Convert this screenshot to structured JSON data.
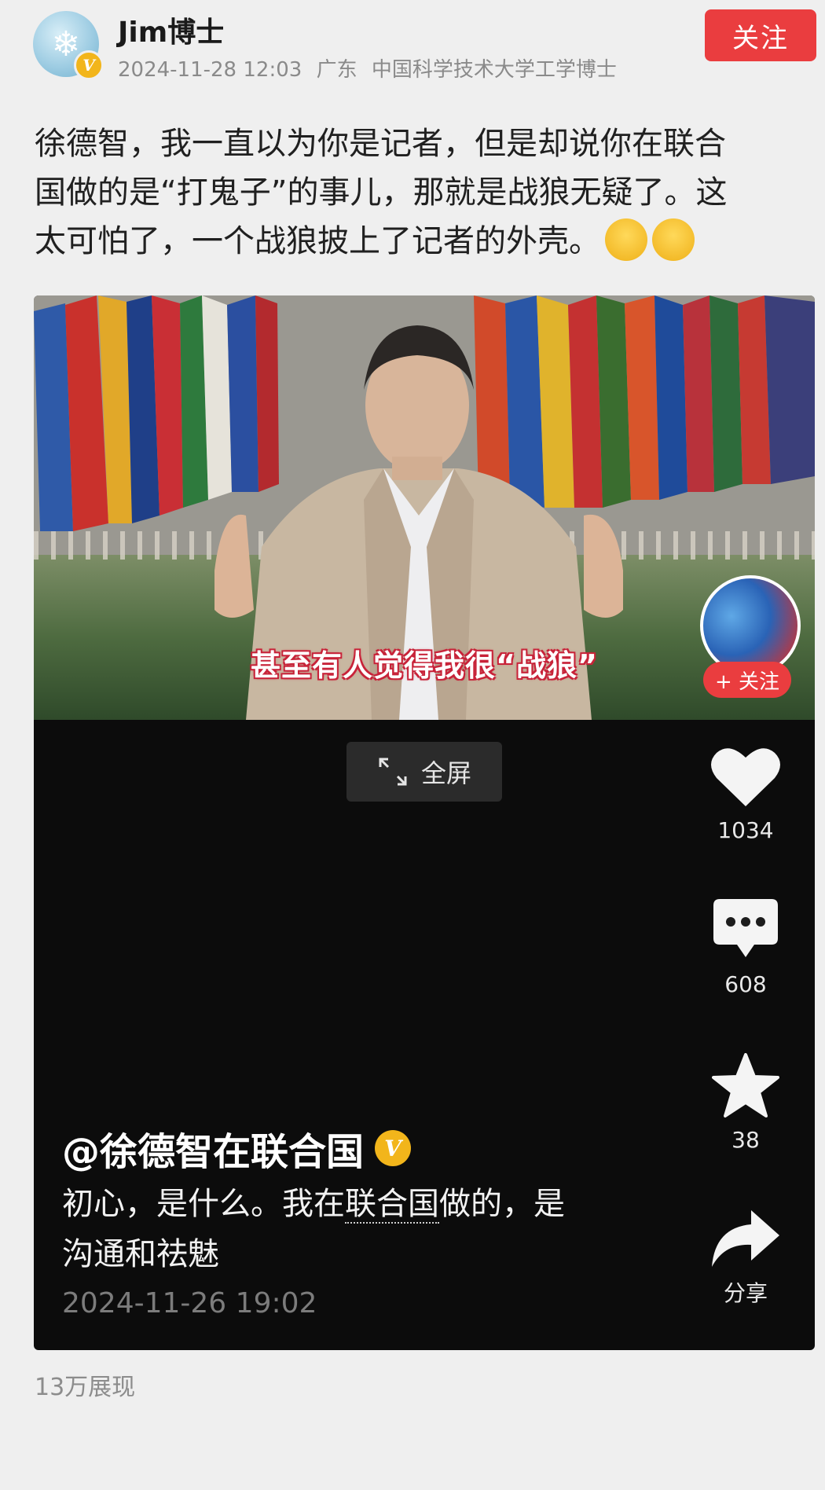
{
  "post": {
    "author": "Jim博士",
    "timestamp": "2024-11-28 12:03",
    "location": "广东",
    "author_title": "中国科学技术大学工学博士",
    "follow_label": "关注",
    "text_line1": "徐德智，我一直以为你是记者，但是却说你在联合",
    "text_line2": "国做的是“打鬼子”的事儿，那就是战狼无疑了。这",
    "text_line3": "太可怕了，一个战狼披上了记者的外壳。",
    "impressions": "13万展现"
  },
  "video": {
    "subtitle": "甚至有人觉得我很“战狼”",
    "creator_follow_label": "+ 关注",
    "fullscreen_label": "全屏",
    "likes": "1034",
    "comments": "608",
    "favorites": "38",
    "share_label": "分享",
    "author": "@徐德智在联合国",
    "caption_part1": "初心，是什么。我在",
    "caption_link": "联合国",
    "caption_part2": "做的，是",
    "caption_line2": "沟通和祛魅",
    "timestamp": "2024-11-26 19:02"
  },
  "icons": {
    "avatar": "snowflake-avatar",
    "verified": "verified-v-badge",
    "emoji": "crying-face-emoji",
    "fullscreen": "expand-arrows-icon",
    "like": "heart-icon",
    "comment": "comment-bubble-icon",
    "favorite": "star-icon",
    "share": "share-arrow-icon"
  },
  "colors": {
    "accent_red": "#ea3d3f",
    "verified_gold": "#f2b51b",
    "video_bg": "#0c0c0c"
  }
}
